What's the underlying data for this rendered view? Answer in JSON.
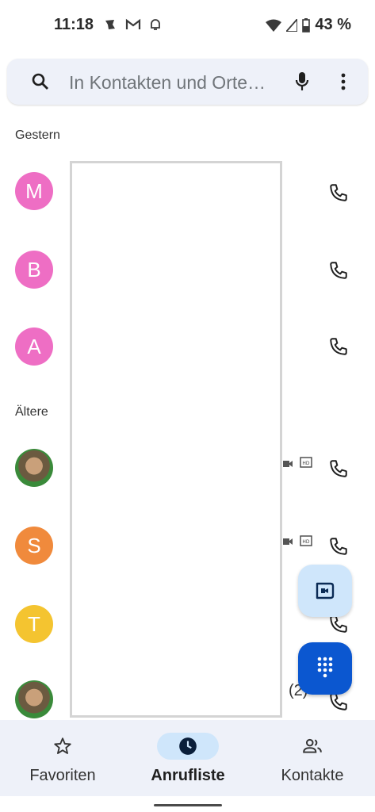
{
  "status_bar": {
    "time": "11:18",
    "battery": "43 %"
  },
  "search": {
    "placeholder": "In Kontakten und Orte…"
  },
  "sections": {
    "yesterday": "Gestern",
    "older": "Ältere"
  },
  "calls": [
    {
      "initial": "M",
      "color": "#ee6ec4"
    },
    {
      "initial": "B",
      "color": "#ee6ec4"
    },
    {
      "initial": "A",
      "color": "#ee6ec4"
    },
    {
      "initial": "",
      "photo": true
    },
    {
      "initial": "S",
      "color": "#f08a3c"
    },
    {
      "initial": "T",
      "color": "#f4c430"
    },
    {
      "initial": "",
      "photo": true,
      "count": "(2)"
    }
  ],
  "nav": {
    "favorites": "Favoriten",
    "call_log": "Anrufliste",
    "contacts": "Kontakte"
  },
  "colors": {
    "accent": "#0b57d0",
    "nav_active": "#cfe6fb",
    "search_bg": "#eef1f9"
  }
}
